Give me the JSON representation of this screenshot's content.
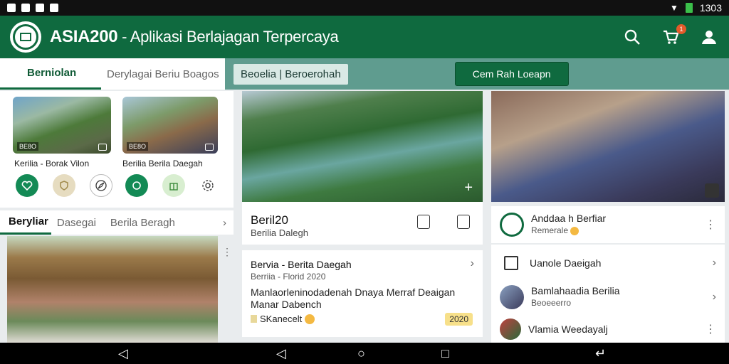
{
  "status_bar": {
    "time": "1303"
  },
  "app": {
    "name": "ASIA200",
    "tagline": " - Aplikasi Berlajagan Terpercaya"
  },
  "tabs": [
    {
      "label": "Berniolan"
    },
    {
      "label": "Derylagai Beriu Boagos"
    }
  ],
  "chip": {
    "label": "Beoelia | Beroerohah"
  },
  "cta": {
    "label": "Cem Rah Loeapn"
  },
  "notification_count": "1",
  "videos": [
    {
      "tag": "BE8O",
      "caption": "Kerilia - Borak Vilon"
    },
    {
      "tag": "BE8O",
      "caption": "Berilia Berila Daegah"
    }
  ],
  "section_tabs": [
    {
      "label": "Beryliar"
    },
    {
      "label": "Dasegai"
    },
    {
      "label": "Berila Beragh"
    }
  ],
  "hero_card": {
    "title": "Beril20",
    "subtitle": "Berilia Dalegh"
  },
  "news_card": {
    "title": "Bervia - Berita Daegah",
    "meta": "Berriia - Florid 2020",
    "body_line1": "Manlaorleninodadenah Dnaya Merraf Deaigan",
    "body_line2": "Manar Dabench",
    "footer": "SKanecelt",
    "badge": "2020"
  },
  "side_list": [
    {
      "title": "Anddaa h Berfiar",
      "sub": "Remerale"
    },
    {
      "title": "Uanole Daeigah",
      "sub": ""
    },
    {
      "title": "Bamlahaadia Berilia",
      "sub": "Beoeeerro"
    },
    {
      "title": "Vlamia Weedayalj",
      "sub": ""
    }
  ],
  "colors": {
    "brand": "#0f6a3f",
    "teal_bar": "#5f9c8f",
    "badge": "#e45a2a"
  },
  "icons": [
    "search-icon",
    "cart-icon",
    "user-icon",
    "back-icon",
    "home-icon",
    "recents-icon"
  ]
}
